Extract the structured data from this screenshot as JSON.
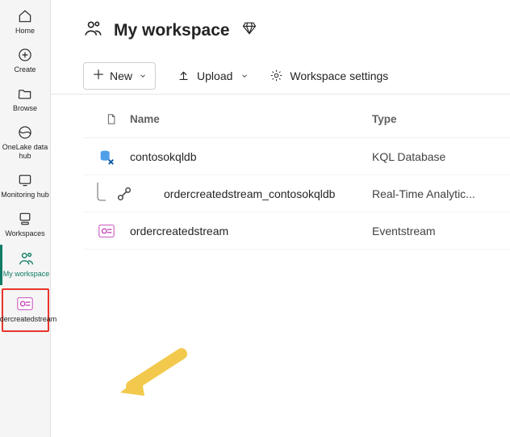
{
  "sidebar": {
    "items": [
      {
        "label": "Home"
      },
      {
        "label": "Create"
      },
      {
        "label": "Browse"
      },
      {
        "label": "OneLake data hub"
      },
      {
        "label": "Monitoring hub"
      },
      {
        "label": "Workspaces"
      },
      {
        "label": "My workspace"
      },
      {
        "label": "ordercreatedstream"
      }
    ]
  },
  "workspace": {
    "title": "My workspace",
    "toolbar": {
      "new_label": "New",
      "upload_label": "Upload",
      "settings_label": "Workspace settings"
    },
    "table": {
      "headers": {
        "name": "Name",
        "type": "Type"
      },
      "rows": [
        {
          "name": "contosokqldb",
          "type": "KQL Database"
        },
        {
          "name": "ordercreatedstream_contosokqldb",
          "type": "Real-Time Analytic..."
        },
        {
          "name": "ordercreatedstream",
          "type": "Eventstream"
        }
      ]
    }
  }
}
